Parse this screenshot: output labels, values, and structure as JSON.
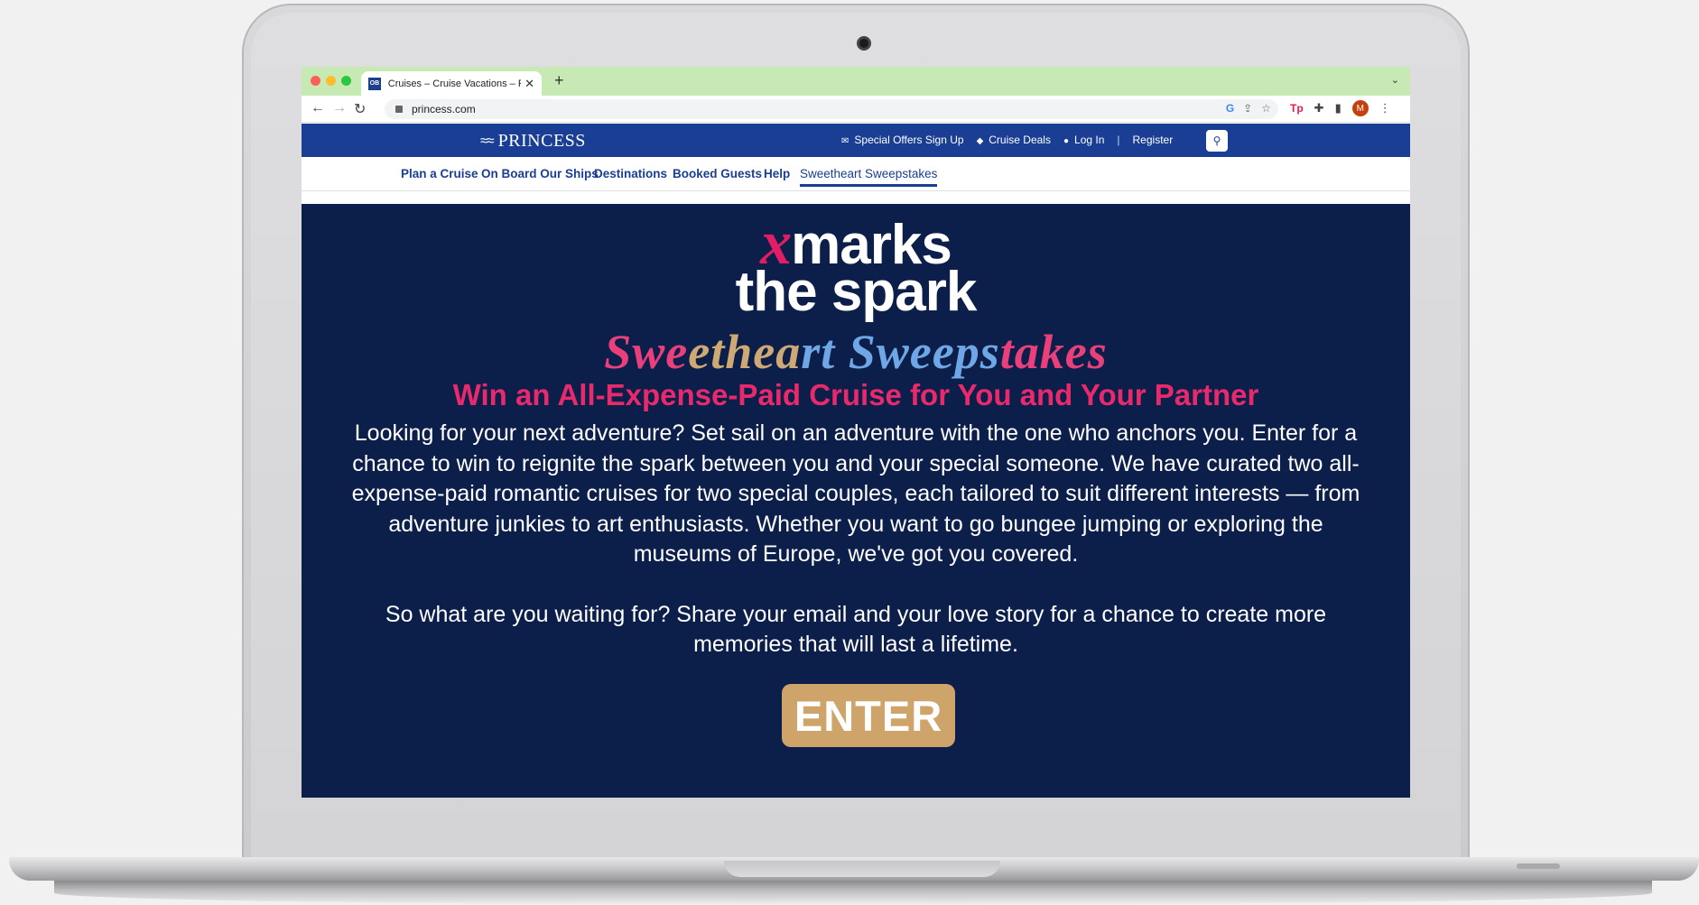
{
  "browser": {
    "tab_title": "Cruises – Cruise Vacations – Fi",
    "favicon_label": "OB",
    "url": "princess.com",
    "avatar_initial": "M",
    "extension_label": "Tp"
  },
  "site": {
    "logo": "PRINCESS",
    "toplinks": {
      "offers": "Special Offers Sign Up",
      "deals": "Cruise Deals",
      "login": "Log In",
      "separator": "|",
      "register": "Register"
    },
    "nav": [
      {
        "label": "Plan a Cruise"
      },
      {
        "label": "On Board Our Ships"
      },
      {
        "label": "Destinations"
      },
      {
        "label": "Booked Guests"
      },
      {
        "label": "Help"
      },
      {
        "label": "Sweetheart Sweepstakes",
        "active": true
      }
    ]
  },
  "hero": {
    "headline_x": "x",
    "headline_line1": "marks",
    "headline_line2": "the spark",
    "sweep_w1": "Swe",
    "sweep_w2": "ethea",
    "sweep_w3": "rt Sweeps",
    "sweep_w4": "takes",
    "subhead": "Win an All-Expense-Paid Cruise for You and Your Partner",
    "paragraph1": "Looking for your next adventure? Set sail on an adventure with the one who anchors you. Enter for a chance to win to reignite the spark between you and your special someone. We have curated two all-expense-paid romantic cruises for two special couples, each tailored to suit different interests — from adventure junkies to art enthusiasts. Whether you want to go bungee jumping or exploring the museums of Europe, we've got you covered.",
    "paragraph2": "So what are you waiting for? Share your email and your love story for a chance to create more memories that will last a lifetime.",
    "enter_label": "ENTER"
  },
  "colors": {
    "brand_blue": "#1a3e93",
    "hero_bg": "#0c1f4a",
    "accent_pink": "#e8296b",
    "gold": "#cfa46a"
  }
}
